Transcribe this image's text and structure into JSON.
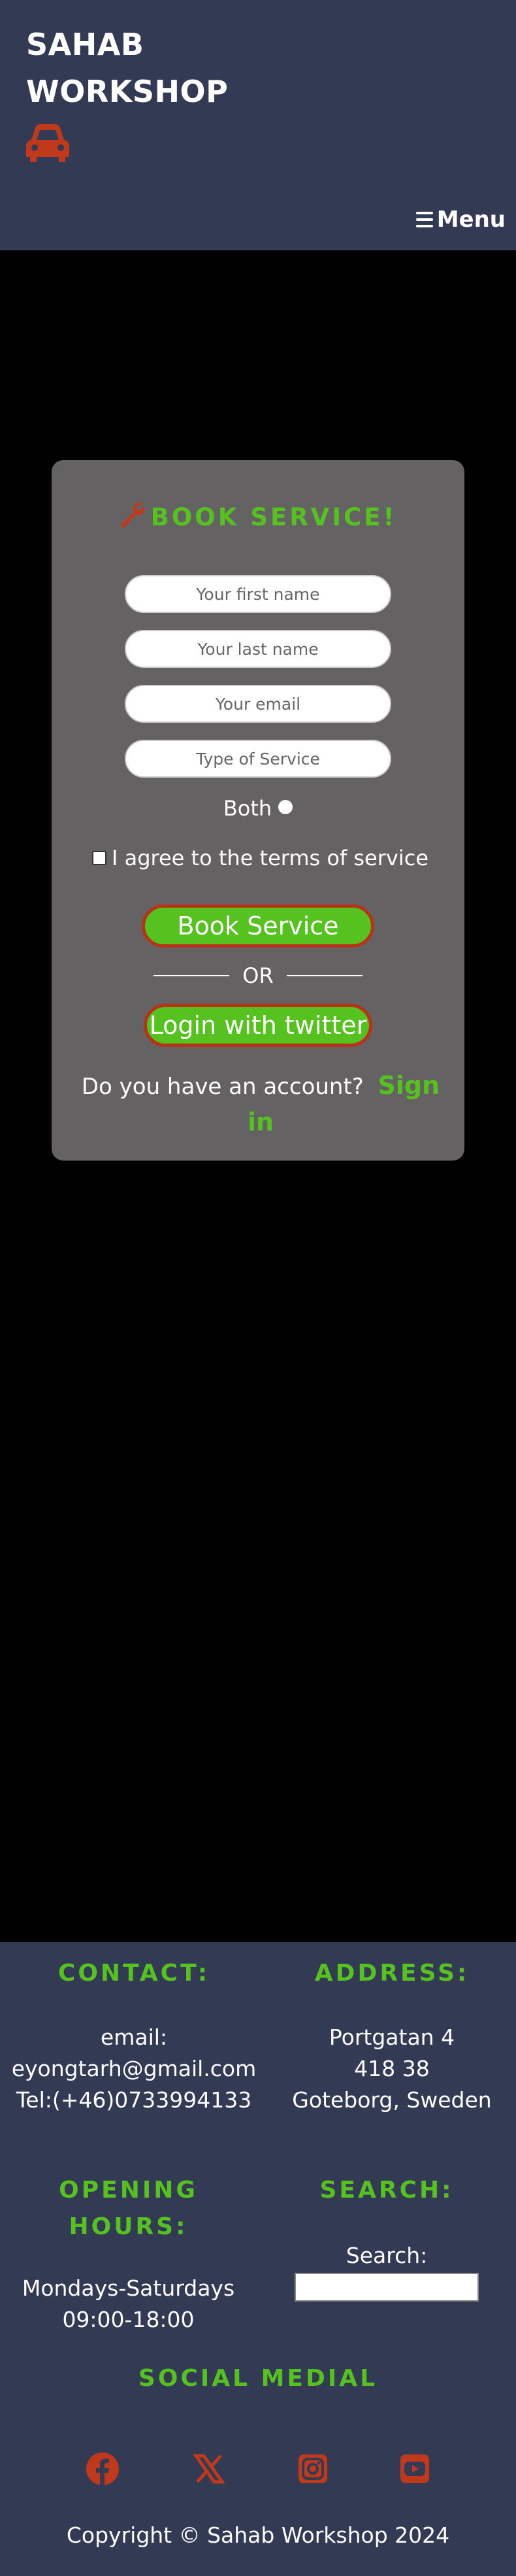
{
  "header": {
    "brand_line1": "SAHAB",
    "brand_line2": "WORKSHOP",
    "menu_label": "Menu",
    "bg_color": "#333a54"
  },
  "booking": {
    "title": "BOOK SERVICE!",
    "first_name_placeholder": "Your first name",
    "last_name_placeholder": "Your last name",
    "email_placeholder": "Your email",
    "service_placeholder": "Type of Service",
    "radio_label": "Both",
    "terms_label": "I agree to the terms of service",
    "book_button": "Book Service",
    "or_label": "OR",
    "twitter_button": "Login with twitter",
    "account_text": "Do you have an account?",
    "sign_in_link": "Sign in",
    "accent_color": "#55c21f",
    "icon_color": "#c0391b"
  },
  "footer": {
    "contact_heading": "CONTACT:",
    "email_line1": "email:",
    "email_line2": "eyongtarh@gmail.com",
    "phone": "Tel:(+46)0733994133",
    "address_heading": "ADDRESS:",
    "address_line1": "Portgatan 4",
    "address_line2": "418 38",
    "address_line3": "Goteborg, Sweden",
    "hours_heading_line1": "OPENING",
    "hours_heading_line2": "HOURS:",
    "hours_line1": "Mondays-Saturdays",
    "hours_line2": "09:00-18:00",
    "search_heading": "SEARCH:",
    "search_label": "Search:",
    "social_heading": "SOCIAL MEDIAL",
    "social_icons": [
      "facebook-icon",
      "x-icon",
      "instagram-icon",
      "youtube-icon"
    ],
    "copyright": "Copyright © Sahab Workshop 2024"
  }
}
